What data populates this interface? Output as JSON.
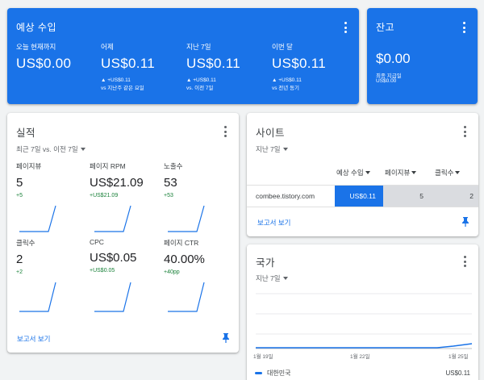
{
  "earnings": {
    "title": "예상 수입",
    "cols": [
      {
        "label": "오늘 현재까지",
        "value": "US$0.00",
        "delta1": "",
        "delta2": ""
      },
      {
        "label": "어제",
        "value": "US$0.11",
        "delta1": "▲ +US$0.11",
        "delta2": "vs 지난주 같은 요일"
      },
      {
        "label": "지난 7일",
        "value": "US$0.11",
        "delta1": "▲ +US$0.11",
        "delta2": "vs. 이전 7일"
      },
      {
        "label": "이번 달",
        "value": "US$0.11",
        "delta1": "▲ +US$0.11",
        "delta2": "vs 전년 동기"
      }
    ]
  },
  "balance": {
    "title": "잔고",
    "value": "$0.00",
    "sub1": "최종 지급일",
    "sub2": "US$0.00"
  },
  "performance": {
    "title": "실적",
    "range": "최근 7일 vs. 이전 7일",
    "metrics": [
      {
        "label": "페이지뷰",
        "value": "5",
        "delta": "+5"
      },
      {
        "label": "페이지 RPM",
        "value": "US$21.09",
        "delta": "+US$21.09"
      },
      {
        "label": "노출수",
        "value": "53",
        "delta": "+53"
      },
      {
        "label": "클릭수",
        "value": "2",
        "delta": "+2"
      },
      {
        "label": "CPC",
        "value": "US$0.05",
        "delta": "+US$0.05"
      },
      {
        "label": "페이지 CTR",
        "value": "40.00%",
        "delta": "+40pp"
      }
    ],
    "link": "보고서 보기"
  },
  "sites": {
    "title": "사이트",
    "range": "지난 7일",
    "headers": [
      "예상 수입",
      "페이지뷰",
      "클릭수"
    ],
    "row": {
      "site": "combee.tistory.com",
      "earnings": "US$0.11",
      "views": "5",
      "clicks": "2"
    },
    "link": "보고서 보기"
  },
  "countries": {
    "title": "국가",
    "range": "지난 7일",
    "x_labels": [
      "1월 19일",
      "1월 22일",
      "1월 25일"
    ],
    "legend": {
      "name": "대한민국",
      "value": "US$0.11"
    }
  },
  "colors": {
    "accent": "#1a73e8",
    "positive": "#188038"
  }
}
